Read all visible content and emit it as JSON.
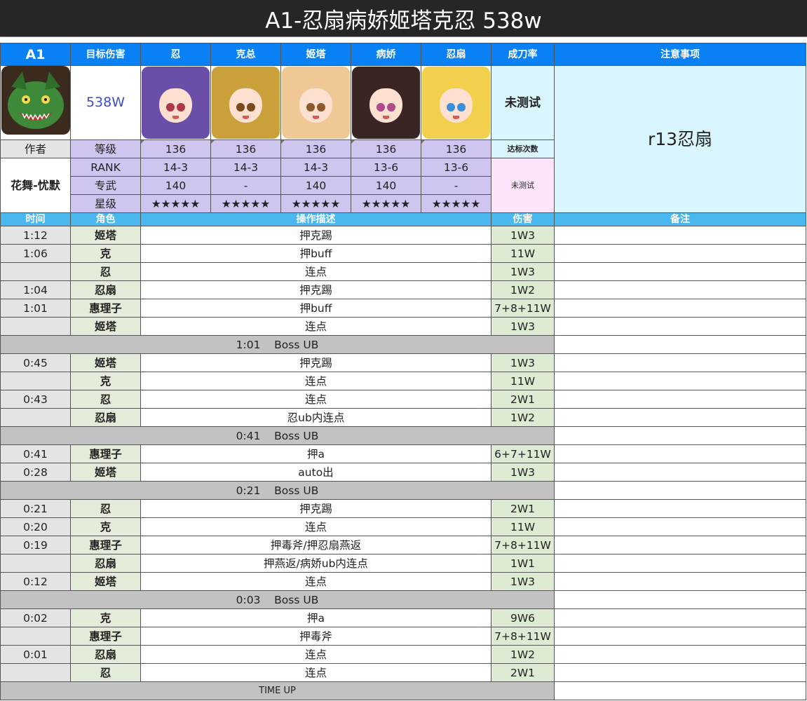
{
  "title": "A1-忍扇病娇姬塔克忍  538w",
  "header": [
    "A1",
    "目标伤害",
    "忍",
    "克总",
    "姬塔",
    "病娇",
    "忍扇",
    "成刀率",
    "注意事项"
  ],
  "target_damage": "538W",
  "success_rate": "未测试",
  "notes_main": "r13忍扇",
  "labels": {
    "author": "作者",
    "level": "等级",
    "rank": "RANK",
    "ue": "专武",
    "star": "星级",
    "reach_count": "达标次数",
    "untested": "未测试"
  },
  "author_name": "花舞-忧默",
  "characters": [
    {
      "name": "忍",
      "level": "136",
      "rank": "14-3",
      "ue": "140",
      "star": "★★★★★",
      "hair": "#6a4fa8",
      "eye": "#b0364a"
    },
    {
      "name": "克总",
      "level": "136",
      "rank": "14-3",
      "ue": "-",
      "star": "★★★★★",
      "hair": "#caa03a",
      "eye": "#7a4a1c"
    },
    {
      "name": "姬塔",
      "level": "136",
      "rank": "14-3",
      "ue": "140",
      "star": "★★★★★",
      "hair": "#efc896",
      "eye": "#8a5a2a"
    },
    {
      "name": "病娇",
      "level": "136",
      "rank": "13-6",
      "ue": "140",
      "star": "★★★★★",
      "hair": "#3a2525",
      "eye": "#b04a8a"
    },
    {
      "name": "忍扇",
      "level": "136",
      "rank": "13-6",
      "ue": "-",
      "star": "★★★★★",
      "hair": "#f3cf4e",
      "eye": "#3a8fd8"
    }
  ],
  "sub_header": [
    "时间",
    "角色",
    "操作描述",
    "伤害",
    "备注"
  ],
  "rows": [
    {
      "type": "act",
      "time": "1:12",
      "role": "姬塔",
      "desc": "押克踢",
      "dmg": "1W3"
    },
    {
      "type": "act",
      "time": "1:06",
      "role": "克",
      "desc": "押buff",
      "dmg": "11W"
    },
    {
      "type": "act",
      "time": "",
      "role": "忍",
      "desc": "连点",
      "dmg": "1W3"
    },
    {
      "type": "act",
      "time": "1:04",
      "role": "忍扇",
      "desc": "押克踢",
      "dmg": "1W2"
    },
    {
      "type": "act",
      "time": "1:01",
      "role": "惠理子",
      "desc": "押buff",
      "dmg": "7+8+11W"
    },
    {
      "type": "act",
      "time": "",
      "role": "姬塔",
      "desc": "连点",
      "dmg": "1W3"
    },
    {
      "type": "ub",
      "text": "1:01    Boss UB"
    },
    {
      "type": "act",
      "time": "0:45",
      "role": "姬塔",
      "desc": "押克踢",
      "dmg": "1W3"
    },
    {
      "type": "act",
      "time": "",
      "role": "克",
      "desc": "连点",
      "dmg": "11W"
    },
    {
      "type": "act",
      "time": "0:43",
      "role": "忍",
      "desc": "连点",
      "dmg": "2W1"
    },
    {
      "type": "act",
      "time": "",
      "role": "忍扇",
      "desc": "忍ub内连点",
      "dmg": "1W2"
    },
    {
      "type": "ub",
      "text": "0:41    Boss UB"
    },
    {
      "type": "act",
      "time": "0:41",
      "role": "惠理子",
      "desc": "押a",
      "dmg": "6+7+11W"
    },
    {
      "type": "act",
      "time": "0:28",
      "role": "姬塔",
      "desc": "auto出",
      "dmg": "1W3"
    },
    {
      "type": "ub",
      "text": "0:21    Boss UB"
    },
    {
      "type": "act",
      "time": "0:21",
      "role": "忍",
      "desc": "押克踢",
      "dmg": "2W1"
    },
    {
      "type": "act",
      "time": "0:20",
      "role": "克",
      "desc": "连点",
      "dmg": "11W"
    },
    {
      "type": "act",
      "time": "0:19",
      "role": "惠理子",
      "desc": "押毒斧/押忍扇燕返",
      "dmg": "7+8+11W"
    },
    {
      "type": "act",
      "time": "",
      "role": "忍扇",
      "desc": "押燕返/病娇ub内连点",
      "dmg": "1W1"
    },
    {
      "type": "act",
      "time": "0:12",
      "role": "姬塔",
      "desc": "连点",
      "dmg": "1W3"
    },
    {
      "type": "ub",
      "text": "0:03    Boss UB"
    },
    {
      "type": "act",
      "time": "0:02",
      "role": "克",
      "desc": "押a",
      "dmg": "9W6"
    },
    {
      "type": "act",
      "time": "",
      "role": "惠理子",
      "desc": "押毒斧",
      "dmg": "7+8+11W"
    },
    {
      "type": "act",
      "time": "0:01",
      "role": "忍扇",
      "desc": "连点",
      "dmg": "1W2"
    },
    {
      "type": "act",
      "time": "",
      "role": "忍",
      "desc": "连点",
      "dmg": "2W1"
    },
    {
      "type": "end",
      "text": "TIME UP"
    }
  ]
}
